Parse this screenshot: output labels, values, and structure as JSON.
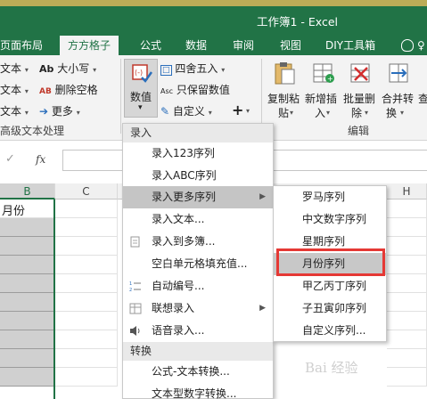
{
  "window": {
    "title": "工作簿1 - Excel"
  },
  "tabs": [
    {
      "label": "页面布局"
    },
    {
      "label": "方方格子",
      "active": true
    },
    {
      "label": "公式"
    },
    {
      "label": "数据"
    },
    {
      "label": "审阅"
    },
    {
      "label": "视图"
    },
    {
      "label": "DIY工具箱"
    }
  ],
  "tell_me": {
    "icon": "lightbulb-icon",
    "label": "♀"
  },
  "ribbon": {
    "left_items": [
      "文本",
      "文本",
      "文本"
    ],
    "case_button": "大小写",
    "delete_space_button": "删除空格",
    "more_button": "更多",
    "text_group_label": "高级文本处理",
    "number_button": {
      "line1": "数值",
      "caret": "▾"
    },
    "round_button": "四舍五入",
    "keep_values_button": "只保留数值",
    "custom_button": "自定义",
    "plus_button": "+",
    "copy_paste": {
      "line1": "复制粘",
      "line2": "贴"
    },
    "insert_new": {
      "line1": "新增插",
      "line2": "入"
    },
    "batch_delete": {
      "line1": "批量删",
      "line2": "除"
    },
    "merge_convert": {
      "line1": "合并转",
      "line2": "换"
    },
    "look": {
      "line1": "查",
      "line2": ""
    },
    "edit_group_label": "编辑"
  },
  "formula_bar": {
    "fx": "fx",
    "check": "✓"
  },
  "grid": {
    "columns": [
      {
        "label": "B"
      },
      {
        "label": "C"
      },
      {
        "label": "H"
      }
    ],
    "b1_value": "月份"
  },
  "menu": {
    "section_input": "录入",
    "items": [
      {
        "label": "录入123序列"
      },
      {
        "label": "录入ABC序列"
      },
      {
        "label": "录入更多序列"
      },
      {
        "label": "录入文本..."
      },
      {
        "label": "录入到多簿..."
      },
      {
        "label": "空白单元格填充值..."
      },
      {
        "label": "自动编号..."
      },
      {
        "label": "联想录入"
      },
      {
        "label": "语音录入..."
      }
    ],
    "section_convert": "转换",
    "convert_items": [
      {
        "label": "公式-文本转换..."
      },
      {
        "label": "文本型数字转换..."
      }
    ]
  },
  "submenu": {
    "items": [
      {
        "label": "罗马序列"
      },
      {
        "label": "中文数字序列"
      },
      {
        "label": "星期序列"
      },
      {
        "label": "月份序列"
      },
      {
        "label": "甲乙丙丁序列"
      },
      {
        "label": "子丑寅卯序列"
      },
      {
        "label": "自定义序列..."
      }
    ]
  },
  "colors": {
    "excel_green": "#217346",
    "highlight_box": "#e53935"
  }
}
